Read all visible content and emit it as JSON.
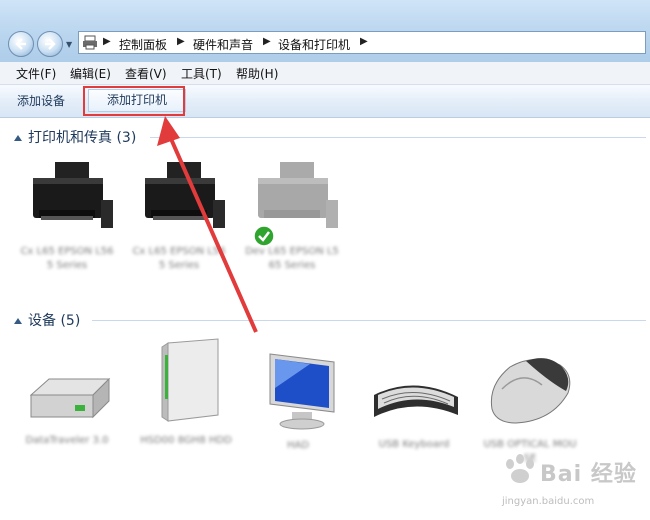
{
  "address": {
    "crumbs": [
      "控制面板",
      "硬件和声音",
      "设备和打印机"
    ]
  },
  "menubar": {
    "file": "文件(F)",
    "edit": "编辑(E)",
    "view": "查看(V)",
    "tools": "工具(T)",
    "help": "帮助(H)"
  },
  "toolbar": {
    "add_device": "添加设备",
    "add_printer": "添加打印机"
  },
  "groups": {
    "printers": {
      "title": "打印机和传真 (3)",
      "items": [
        {
          "label": "Cx L65 EPSON L565 Series",
          "icon": "printer-icon"
        },
        {
          "label": "Cx L65 EPSON L565 Series",
          "icon": "printer-icon"
        },
        {
          "label": "Dev L65 EPSON L565 Series",
          "icon": "printer-icon",
          "state": "default"
        }
      ]
    },
    "devices": {
      "title": "设备 (5)",
      "items": [
        {
          "label": "DataTraveler 3.0",
          "icon": "drive-icon"
        },
        {
          "label": "HSD00 8GH8 HDD",
          "icon": "external-drive-icon"
        },
        {
          "label": "HAD",
          "icon": "monitor-icon"
        },
        {
          "label": "USB Keyboard",
          "icon": "keyboard-icon"
        },
        {
          "label": "USB OPTICAL MOUSE",
          "icon": "mouse-icon"
        }
      ]
    }
  },
  "watermark": {
    "brand": "Bai 经验",
    "url": "jingyan.baidu.com"
  },
  "colors": {
    "highlight": "#e23b3b",
    "accent": "#1e395b"
  }
}
